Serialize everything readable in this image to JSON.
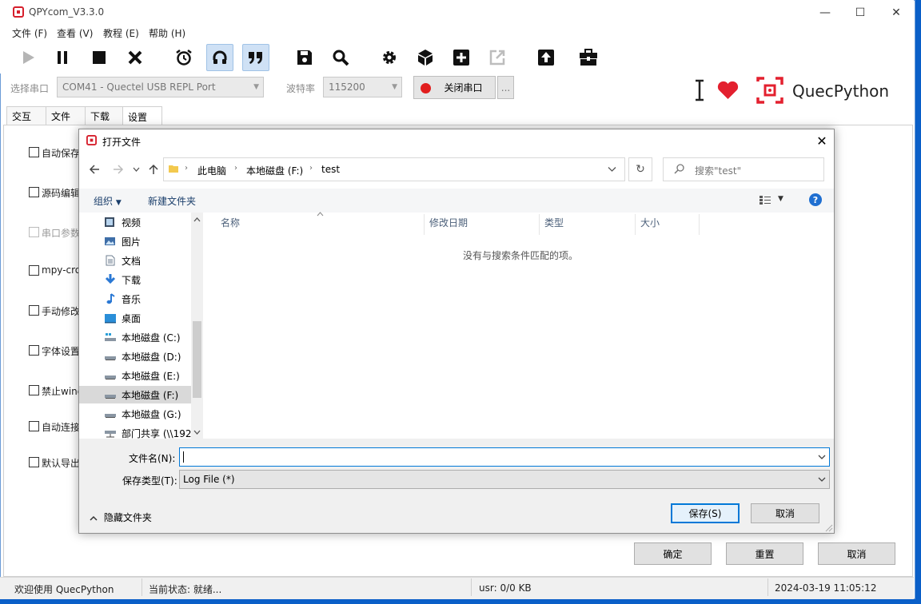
{
  "app": {
    "title": "QPYcom_V3.3.0",
    "menus": [
      "文件 (F)",
      "查看 (V)",
      "教程 (E)",
      "帮助 (H)"
    ]
  },
  "port_bar": {
    "port_label": "选择串口",
    "port_value": "COM41 - Quectel USB REPL Port",
    "baud_label": "波特率",
    "baud_value": "115200",
    "close_port_label": "关闭串口",
    "more_label": "...",
    "brand": "QuecPython",
    "brand_color": "#e3202f",
    "record_color": "#e11d1d"
  },
  "tabs": [
    "交互",
    "文件",
    "下载",
    "设置"
  ],
  "settings": [
    {
      "label": "自动保存",
      "enabled": true
    },
    {
      "label": "源码编辑",
      "enabled": true
    },
    {
      "label": "串口参数",
      "enabled": false
    },
    {
      "label": "mpy-cro",
      "enabled": true
    },
    {
      "label": "手动修改",
      "enabled": true
    },
    {
      "label": "字体设置",
      "enabled": true
    },
    {
      "label": "禁止wind",
      "enabled": true
    },
    {
      "label": "自动连接",
      "enabled": true
    },
    {
      "label": "默认导出",
      "enabled": true
    }
  ],
  "panel_buttons": {
    "ok": "确定",
    "reset": "重置",
    "cancel": "取消"
  },
  "status": {
    "welcome": "欢迎使用 QuecPython",
    "state": "当前状态: 就绪...",
    "usr": "usr: 0/0 KB",
    "datetime": "2024-03-19 11:05:12"
  },
  "dialog": {
    "title": "打开文件",
    "breadcrumb": [
      "此电脑",
      "本地磁盘 (F:)",
      "test"
    ],
    "search_placeholder": "搜索\"test\"",
    "organize": "组织",
    "new_folder": "新建文件夹",
    "help": "?",
    "nav_items": [
      {
        "label": "视频",
        "icon": "video-icon"
      },
      {
        "label": "图片",
        "icon": "picture-icon"
      },
      {
        "label": "文档",
        "icon": "document-icon"
      },
      {
        "label": "下载",
        "icon": "download-icon"
      },
      {
        "label": "音乐",
        "icon": "music-icon"
      },
      {
        "label": "桌面",
        "icon": "desktop-icon"
      },
      {
        "label": "本地磁盘 (C:)",
        "icon": "drive-icon"
      },
      {
        "label": "本地磁盘 (D:)",
        "icon": "drive-icon"
      },
      {
        "label": "本地磁盘 (E:)",
        "icon": "drive-icon"
      },
      {
        "label": "本地磁盘 (F:)",
        "icon": "drive-icon",
        "selected": true
      },
      {
        "label": "本地磁盘 (G:)",
        "icon": "drive-icon"
      },
      {
        "label": "部门共享 (\\\\192",
        "icon": "network-drive-icon"
      }
    ],
    "columns": [
      "名称",
      "修改日期",
      "类型",
      "大小"
    ],
    "empty_message": "没有与搜索条件匹配的项。",
    "filename_label": "文件名(N):",
    "filename_value": "",
    "filetype_label": "保存类型(T):",
    "filetype_value": "Log File (*)",
    "hide_folders": "隐藏文件夹",
    "save": "保存(S)",
    "cancel": "取消"
  }
}
